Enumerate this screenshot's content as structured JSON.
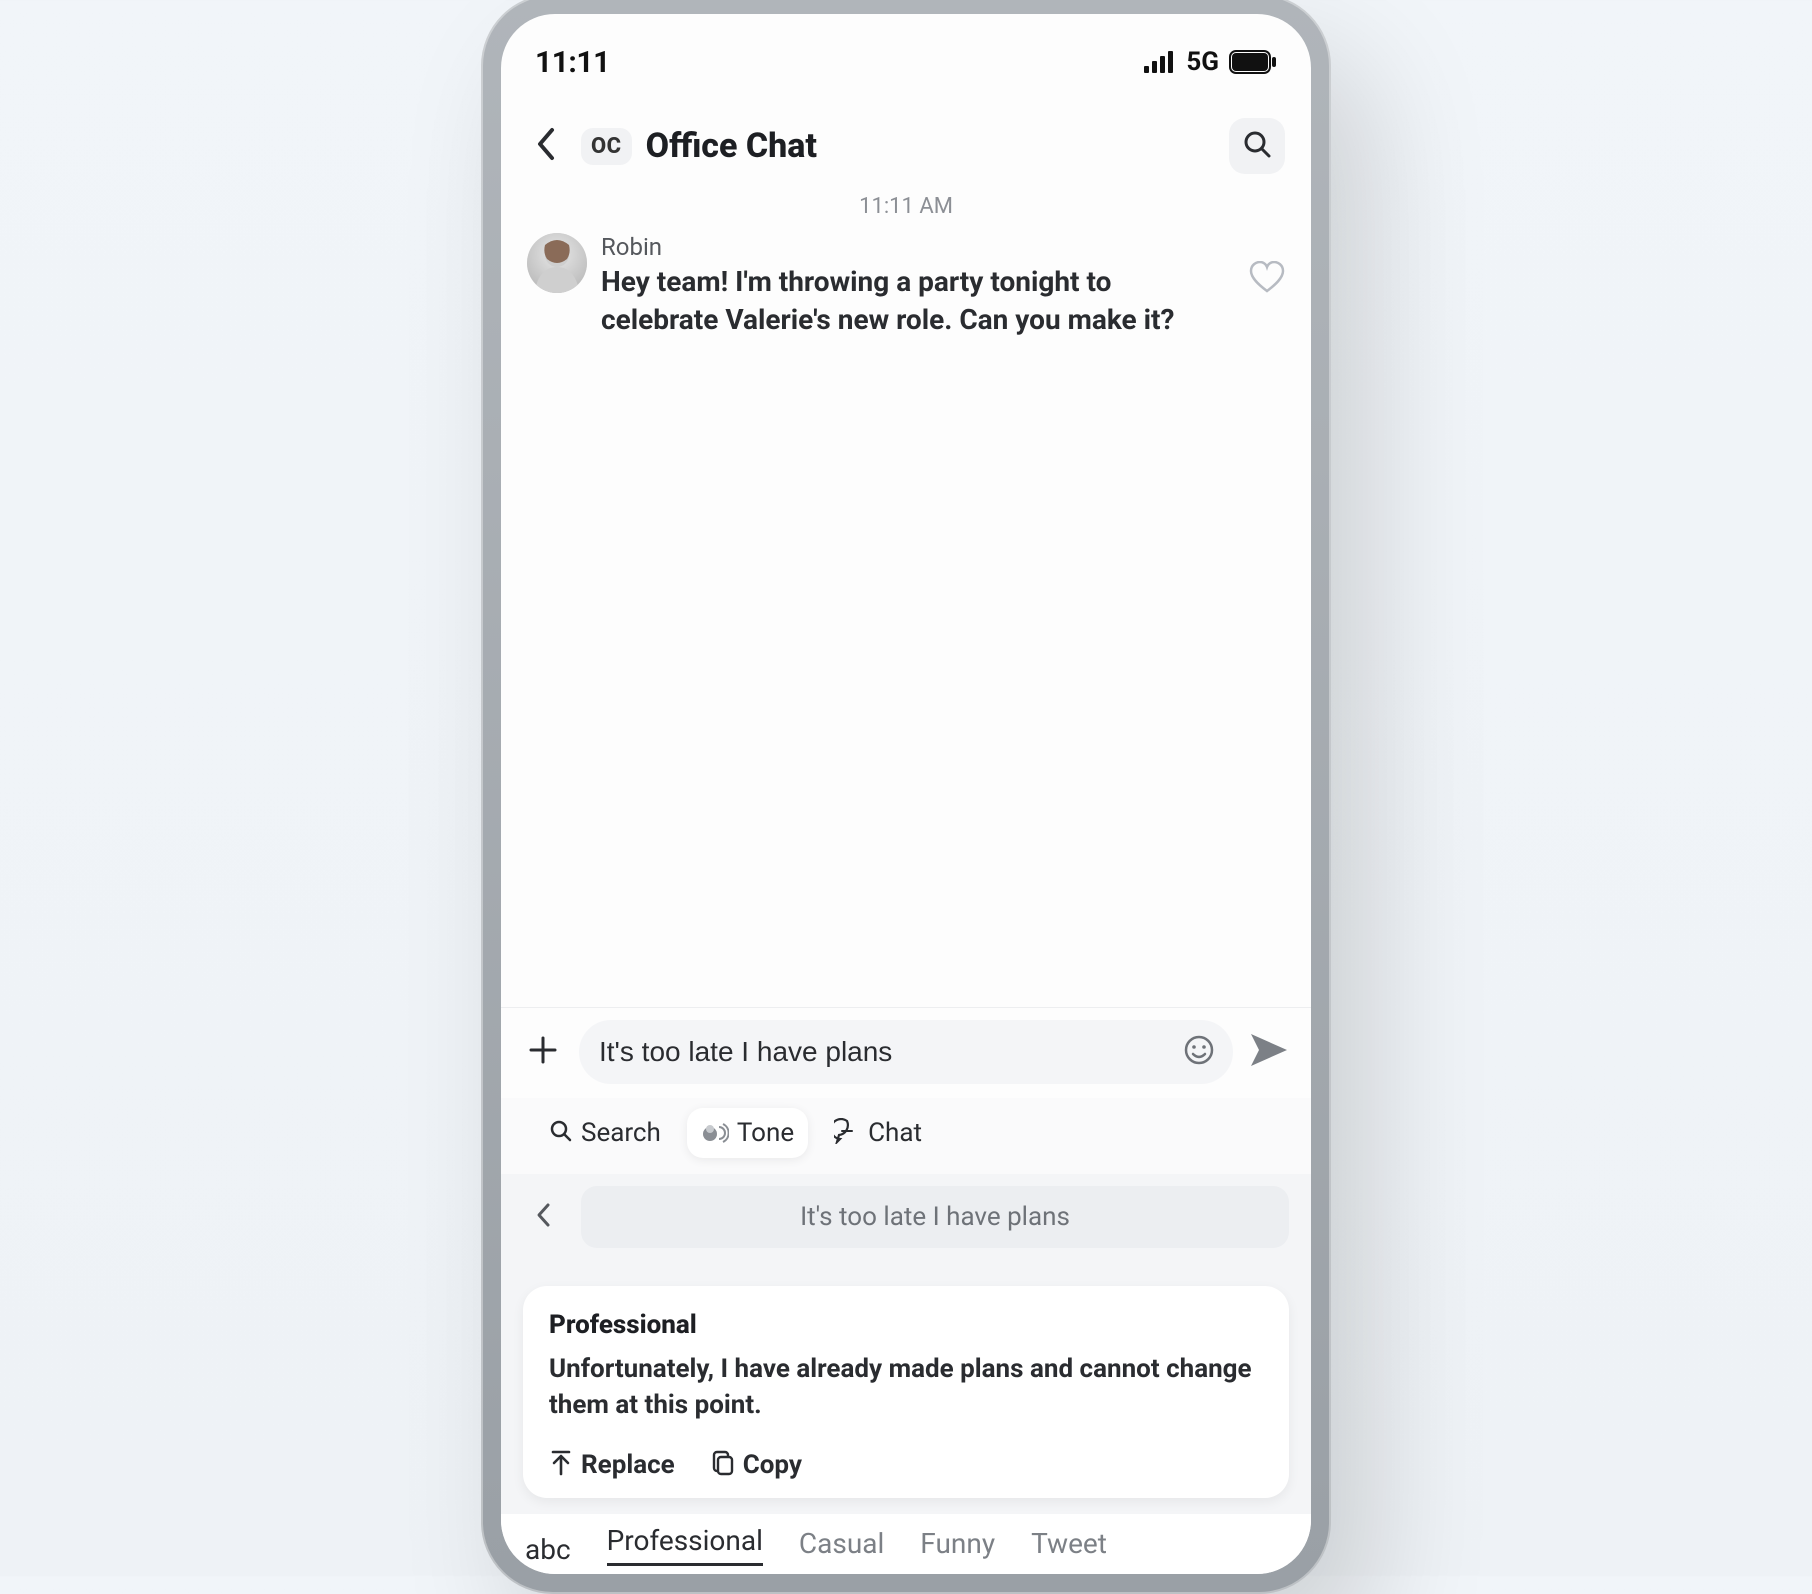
{
  "statusbar": {
    "time": "11:11",
    "network_label": "5G"
  },
  "header": {
    "avatar_initials": "OC",
    "title": "Office Chat"
  },
  "thread": {
    "timestamp": "11:11 AM",
    "message": {
      "sender": "Robin",
      "text": "Hey team! I'm throwing a party tonight to celebrate Valerie's new role. Can you make it?"
    }
  },
  "compose": {
    "value": "It's too late I have plans"
  },
  "toolbar": {
    "search_label": "Search",
    "tone_label": "Tone",
    "chat_label": "Chat"
  },
  "echo": {
    "value": "It's too late I have plans"
  },
  "suggestion": {
    "title": "Professional",
    "body": "Unfortunately, I have already made plans and cannot change them at this point.",
    "replace_label": "Replace",
    "copy_label": "Copy"
  },
  "tone_tabs": {
    "mode_label": "abc",
    "items": [
      "Professional",
      "Casual",
      "Funny",
      "Tweet"
    ],
    "active_index": 0
  }
}
